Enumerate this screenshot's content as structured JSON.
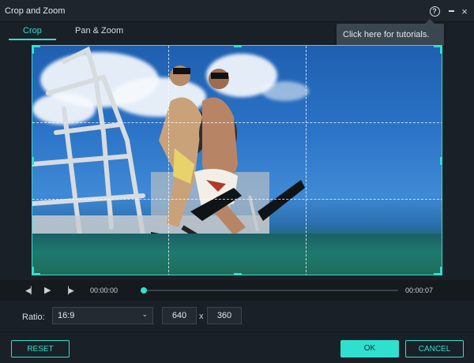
{
  "window": {
    "title": "Crop and Zoom",
    "help_glyph": "?",
    "close_glyph": "×"
  },
  "tabs": [
    {
      "label": "Crop",
      "active": true
    },
    {
      "label": "Pan & Zoom",
      "active": false
    }
  ],
  "tooltip": {
    "text": "Click here for tutorials."
  },
  "player": {
    "current_time": "00:00:00",
    "total_time": "00:00:07",
    "progress": 0.0,
    "prev_glyph": "◀▏",
    "play_glyph": "▶",
    "next_glyph": "▕▶"
  },
  "crop": {
    "ratio_label": "Ratio:",
    "ratio_value": "16:9",
    "width": "640",
    "height": "360",
    "separator": "x"
  },
  "buttons": {
    "reset": "RESET",
    "ok": "OK",
    "cancel": "CANCEL"
  },
  "colors": {
    "accent": "#2fe0cf",
    "background": "#1a2027",
    "tooltip_bg": "#3a4650"
  },
  "icons": {
    "help": "help-icon",
    "minimize": "minimize-icon",
    "close": "close-icon",
    "prev_frame": "prev-frame-icon",
    "play": "play-icon",
    "next_frame": "next-frame-icon",
    "dropdown": "chevron-down-icon"
  }
}
